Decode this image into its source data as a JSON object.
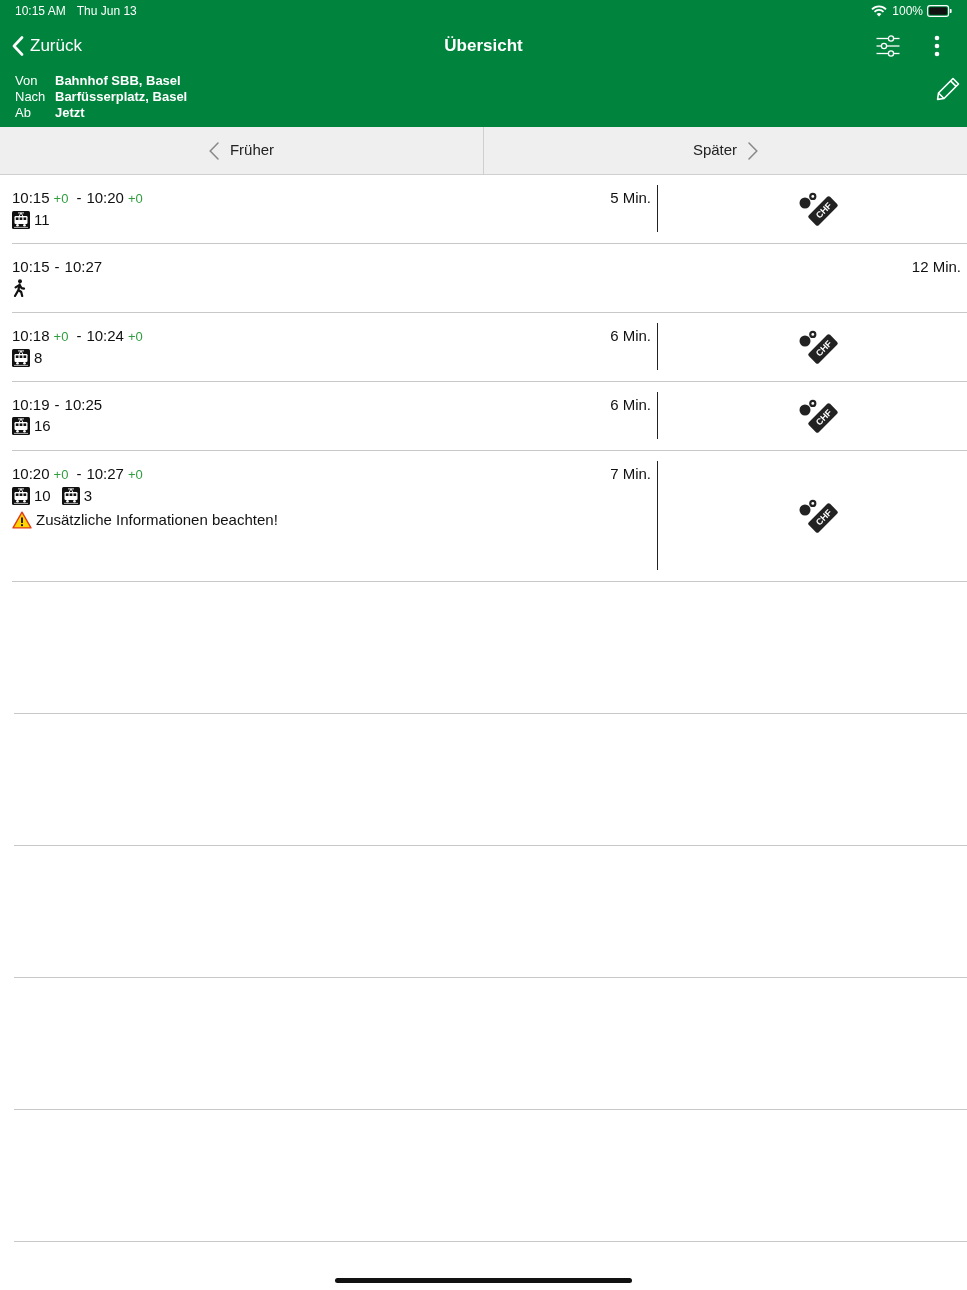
{
  "status_bar": {
    "time": "10:15 AM",
    "date": "Thu Jun 13",
    "battery": "100%"
  },
  "nav_bar": {
    "back": "Zurück",
    "title": "Übersicht"
  },
  "query": [
    {
      "label": "Von",
      "value": "Bahnhof SBB, Basel"
    },
    {
      "label": "Nach",
      "value": "Barfüsserplatz, Basel"
    },
    {
      "label": "Ab",
      "value": "Jetzt"
    }
  ],
  "pager": {
    "earlier": "Früher",
    "later": "Später"
  },
  "connections": [
    {
      "kind": "transit",
      "departure": {
        "time": "10:15",
        "delay": "+0"
      },
      "separator": "-",
      "arrival": {
        "time": "10:20",
        "delay": "+0"
      },
      "duration": "5 Min.",
      "ticket": "CHF",
      "legs": [
        {
          "kind": "tram",
          "line": "11"
        }
      ]
    },
    {
      "kind": "walk",
      "departure": {
        "time": "10:15"
      },
      "separator": "-",
      "arrival": {
        "time": "10:27"
      },
      "duration": "12 Min.",
      "legs": [
        {
          "kind": "walk"
        }
      ]
    },
    {
      "kind": "transit",
      "departure": {
        "time": "10:18",
        "delay": "+0"
      },
      "separator": "-",
      "arrival": {
        "time": "10:24",
        "delay": "+0"
      },
      "duration": "6 Min.",
      "ticket": "CHF",
      "legs": [
        {
          "kind": "tram",
          "line": "8"
        }
      ]
    },
    {
      "kind": "transit",
      "departure": {
        "time": "10:19"
      },
      "separator": "-",
      "arrival": {
        "time": "10:25"
      },
      "duration": "6 Min.",
      "ticket": "CHF",
      "legs": [
        {
          "kind": "tram",
          "line": "16"
        }
      ]
    },
    {
      "kind": "transit",
      "departure": {
        "time": "10:20",
        "delay": "+0"
      },
      "separator": "-",
      "arrival": {
        "time": "10:27",
        "delay": "+0"
      },
      "duration": "7 Min.",
      "ticket": "CHF",
      "legs": [
        {
          "kind": "tram",
          "line": "10"
        },
        {
          "kind": "tram",
          "line": "3"
        }
      ],
      "notice": "Zusätzliche Informationen beachten!"
    }
  ]
}
